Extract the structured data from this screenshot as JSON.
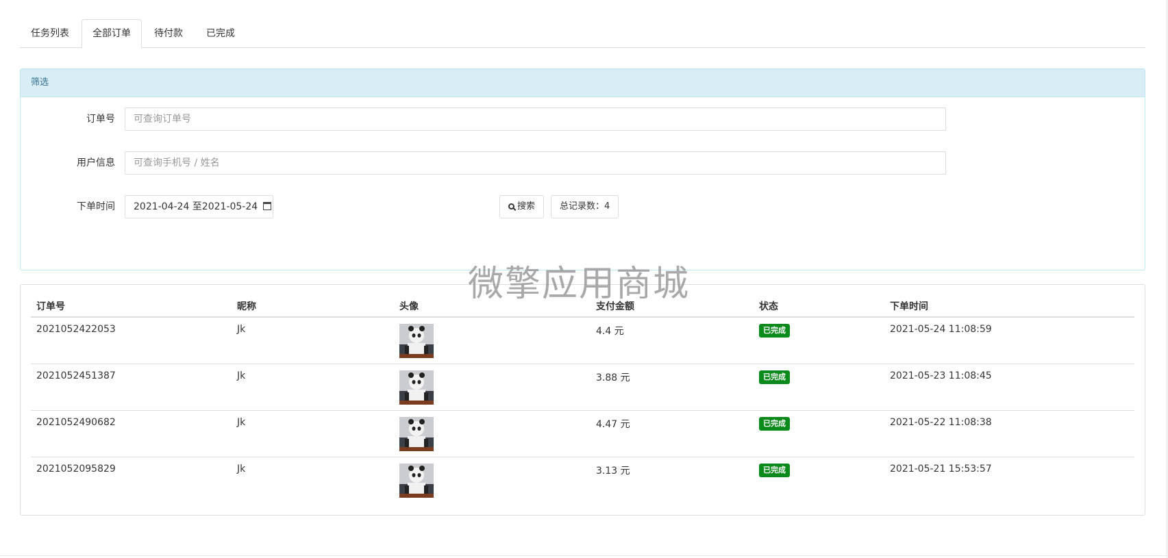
{
  "tabs": [
    {
      "label": "任务列表",
      "active": false
    },
    {
      "label": "全部订单",
      "active": true
    },
    {
      "label": "待付款",
      "active": false
    },
    {
      "label": "已完成",
      "active": false
    }
  ],
  "filter": {
    "title": "筛选",
    "order_no": {
      "label": "订单号",
      "placeholder": "可查询订单号"
    },
    "user_info": {
      "label": "用户信息",
      "placeholder": "可查询手机号 / 姓名"
    },
    "order_time": {
      "label": "下单时间",
      "value": "2021-04-24 至2021-05-24"
    },
    "search_label": "搜索",
    "total_label": "总记录数：4"
  },
  "watermark": "微擎应用商城",
  "table": {
    "headers": [
      "订单号",
      "昵称",
      "头像",
      "支付金额",
      "状态",
      "下单时间"
    ],
    "rows": [
      {
        "order_no": "2021052422053",
        "nickname": "Jk",
        "amount": "4.4 元",
        "status": "已完成",
        "time": "2021-05-24 11:08:59"
      },
      {
        "order_no": "2021052451387",
        "nickname": "Jk",
        "amount": "3.88 元",
        "status": "已完成",
        "time": "2021-05-23 11:08:45"
      },
      {
        "order_no": "2021052490682",
        "nickname": "Jk",
        "amount": "4.47 元",
        "status": "已完成",
        "time": "2021-05-22 11:08:38"
      },
      {
        "order_no": "2021052095829",
        "nickname": "Jk",
        "amount": "3.13 元",
        "status": "已完成",
        "time": "2021-05-21 15:53:57"
      }
    ]
  },
  "colors": {
    "panel_heading_bg": "#d9edf7",
    "panel_heading_text": "#31708f",
    "status_badge": "#0a8a1a"
  }
}
